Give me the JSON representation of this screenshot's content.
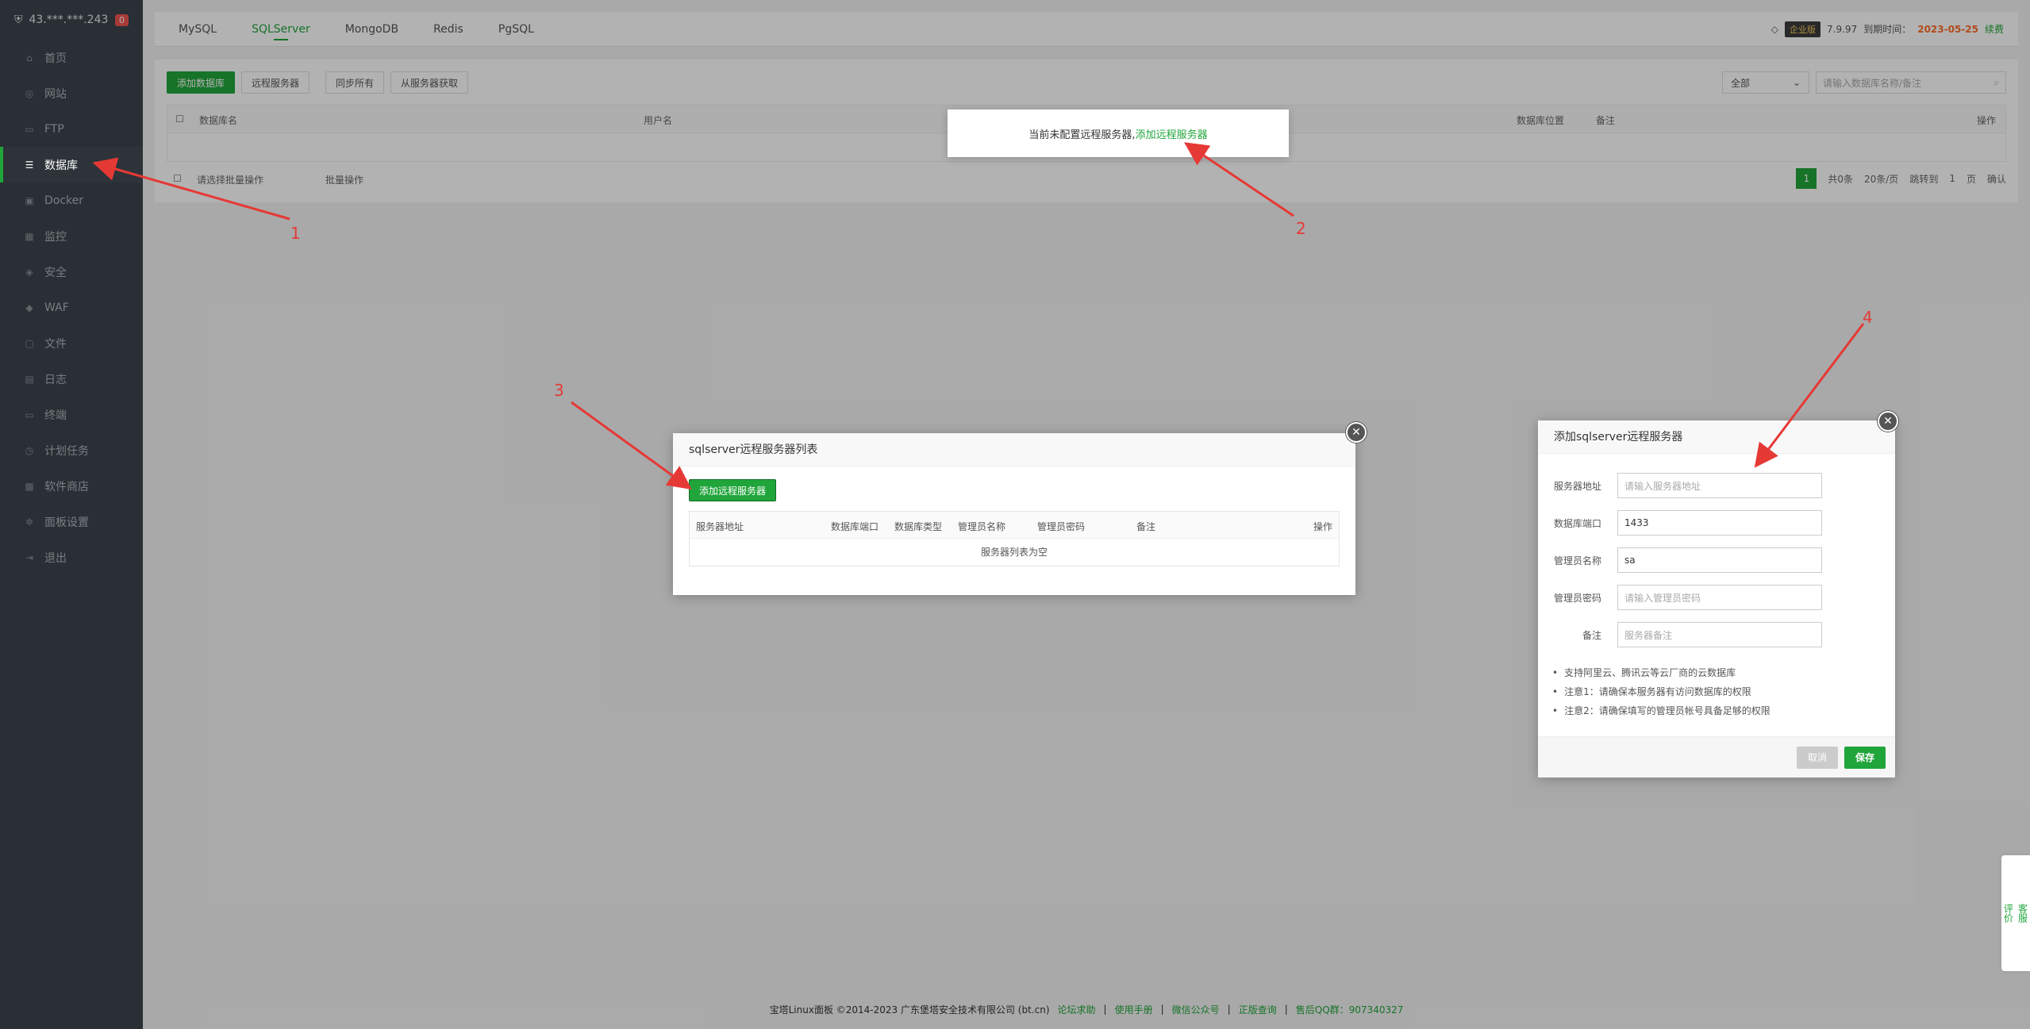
{
  "sidebar": {
    "host": "43.***.***.243",
    "badge": "0",
    "items": [
      {
        "label": "首页",
        "icon": "home-icon"
      },
      {
        "label": "网站",
        "icon": "globe-icon"
      },
      {
        "label": "FTP",
        "icon": "ftp-icon"
      },
      {
        "label": "数据库",
        "icon": "database-icon"
      },
      {
        "label": "Docker",
        "icon": "docker-icon"
      },
      {
        "label": "监控",
        "icon": "monitor-icon"
      },
      {
        "label": "安全",
        "icon": "shield-icon"
      },
      {
        "label": "WAF",
        "icon": "waf-icon"
      },
      {
        "label": "文件",
        "icon": "folder-icon"
      },
      {
        "label": "日志",
        "icon": "log-icon"
      },
      {
        "label": "终端",
        "icon": "terminal-icon"
      },
      {
        "label": "计划任务",
        "icon": "clock-icon"
      },
      {
        "label": "软件商店",
        "icon": "grid-icon"
      },
      {
        "label": "面板设置",
        "icon": "gear-icon"
      },
      {
        "label": "退出",
        "icon": "logout-icon"
      }
    ]
  },
  "tabs": [
    "MySQL",
    "SQLServer",
    "MongoDB",
    "Redis",
    "PgSQL"
  ],
  "version": {
    "edition": "企业版",
    "number": "7.9.97",
    "expire_label": "到期时间：",
    "expire_date": "2023-05-25",
    "renew": "续费"
  },
  "toolbar": {
    "add_db": "添加数据库",
    "remote_server": "远程服务器",
    "sync_all": "同步所有",
    "fetch_from_server": "从服务器获取"
  },
  "search": {
    "filter": "全部",
    "placeholder": "请输入数据库名称/备注"
  },
  "table": {
    "col_name": "数据库名",
    "col_user": "用户名",
    "col_location": "数据库位置",
    "col_note": "备注",
    "col_ops": "操作"
  },
  "footer_bar": {
    "batch_select": "请选择批量操作",
    "batch_btn": "批量操作",
    "total": "共0条",
    "per_page": "20条/页",
    "goto": "跳转到",
    "page": "1",
    "page_unit": "页",
    "confirm": "确认"
  },
  "hint": {
    "text": "当前未配置远程服务器,",
    "link": "添加远程服务器"
  },
  "server_list_dialog": {
    "title": "sqlserver远程服务器列表",
    "add_button": "添加远程服务器",
    "columns": [
      "服务器地址",
      "数据库端口",
      "数据库类型",
      "管理员名称",
      "管理员密码",
      "备注",
      "操作"
    ],
    "empty": "服务器列表为空"
  },
  "add_dialog": {
    "title": "添加sqlserver远程服务器",
    "fields": [
      {
        "label": "服务器地址",
        "value": "",
        "placeholder": "请输入服务器地址"
      },
      {
        "label": "数据库端口",
        "value": "1433",
        "placeholder": ""
      },
      {
        "label": "管理员名称",
        "value": "sa",
        "placeholder": ""
      },
      {
        "label": "管理员密码",
        "value": "",
        "placeholder": "请输入管理员密码"
      },
      {
        "label": "备注",
        "value": "",
        "placeholder": "服务器备注"
      }
    ],
    "tips": [
      "支持阿里云、腾讯云等云厂商的云数据库",
      "注意1：请确保本服务器有访问数据库的权限",
      "注意2：请确保填写的管理员帐号具备足够的权限"
    ],
    "cancel": "取消",
    "save": "保存"
  },
  "page_footer": {
    "copyright": "宝塔Linux面板 ©2014-2023 广东堡塔安全技术有限公司 (bt.cn)",
    "links": [
      "论坛求助",
      "使用手册",
      "微信公众号",
      "正版查询",
      "售后QQ群：907340327"
    ]
  },
  "side_float": [
    "客服",
    "评价"
  ],
  "annotations": [
    "1",
    "2",
    "3",
    "4"
  ],
  "colors": {
    "accent": "#20a53a",
    "annotation": "#e53935",
    "sidebar": "#3c444d"
  }
}
